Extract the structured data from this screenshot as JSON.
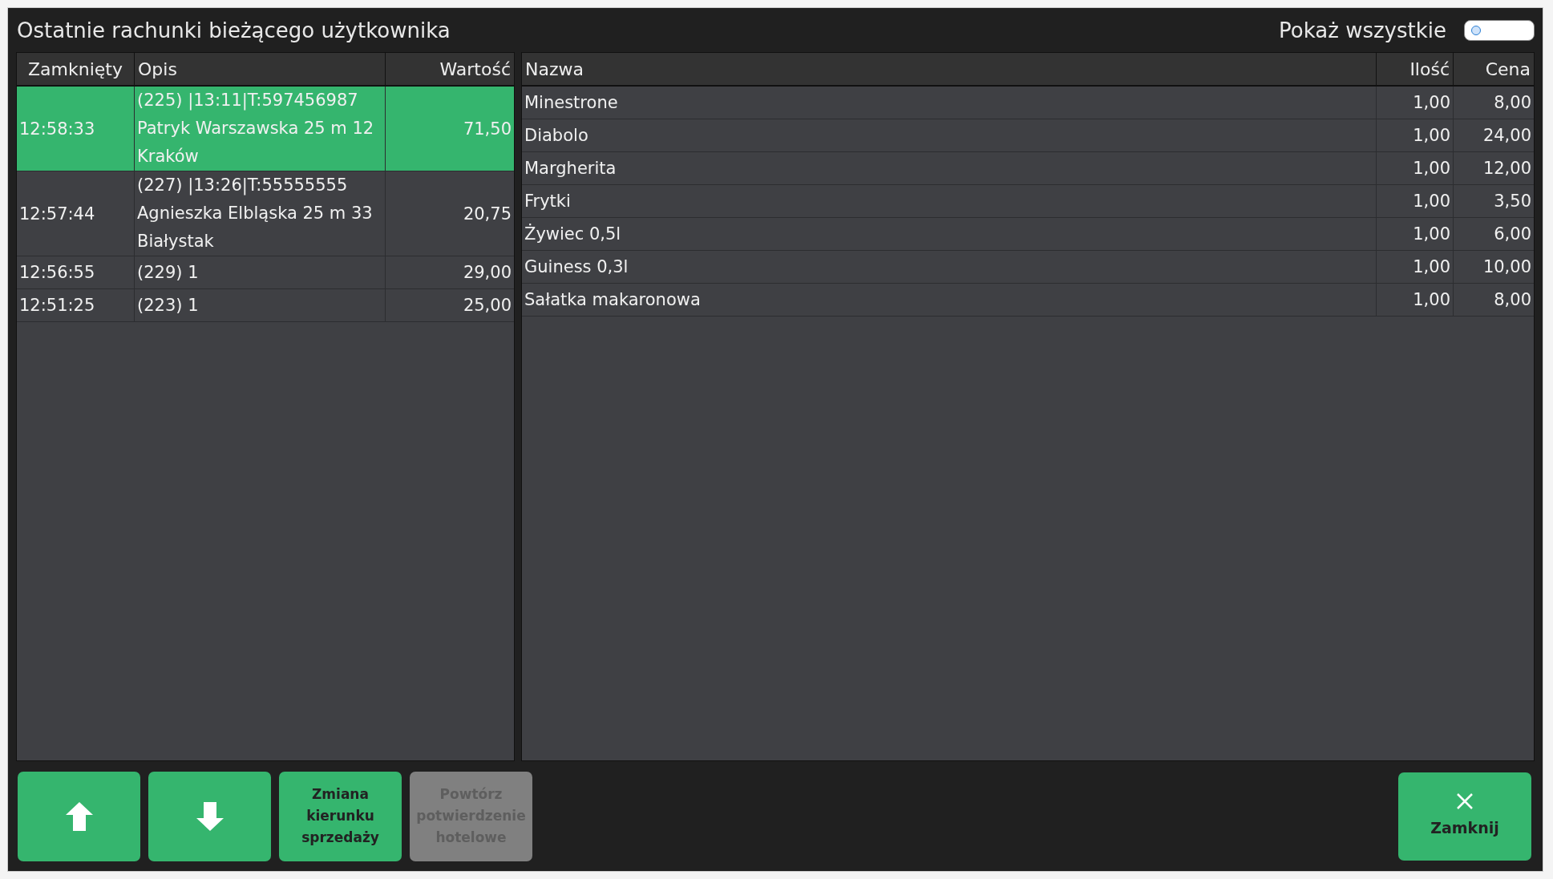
{
  "window": {
    "title": "Ostatnie rachunki bieżącego użytkownika"
  },
  "show_all": {
    "label": "Pokaż wszystkie",
    "on": false
  },
  "bills": {
    "columns": [
      "Zamknięty",
      "Opis",
      "Wartość"
    ],
    "rows": [
      {
        "closed": "12:58:33",
        "description": [
          "(225) |13:11|T:597456987",
          "Patryk Warszawska 25 m 12",
          "Kraków"
        ],
        "value": "71,50",
        "selected": true
      },
      {
        "closed": "12:57:44",
        "description": [
          "(227) |13:26|T:55555555",
          "Agnieszka Elbląska 25 m 33",
          "Białystak"
        ],
        "value": "20,75",
        "selected": false
      },
      {
        "closed": "12:56:55",
        "description": [
          "(229) 1"
        ],
        "value": "29,00",
        "selected": false
      },
      {
        "closed": "12:51:25",
        "description": [
          "(223) 1"
        ],
        "value": "25,00",
        "selected": false
      }
    ]
  },
  "items": {
    "columns": [
      "Nazwa",
      "Ilość",
      "Cena"
    ],
    "rows": [
      {
        "name": "Minestrone",
        "quantity": "1,00",
        "price": "8,00"
      },
      {
        "name": "Diabolo",
        "quantity": "1,00",
        "price": "24,00"
      },
      {
        "name": "Margherita",
        "quantity": "1,00",
        "price": "12,00"
      },
      {
        "name": "Frytki",
        "quantity": "1,00",
        "price": "3,50"
      },
      {
        "name": "Żywiec 0,5l",
        "quantity": "1,00",
        "price": "6,00"
      },
      {
        "name": "Guiness 0,3l",
        "quantity": "1,00",
        "price": "10,00"
      },
      {
        "name": "Sałatka makaronowa",
        "quantity": "1,00",
        "price": "8,00"
      }
    ]
  },
  "buttons": [
    {
      "kind": "up",
      "disabled": false
    },
    {
      "kind": "down",
      "disabled": false
    },
    {
      "kind": "text",
      "label": "Zmiana kierunku sprzedaży",
      "disabled": false
    },
    {
      "kind": "text",
      "label": "Powtórz potwierdzenie hotelowe",
      "disabled": true
    }
  ],
  "close_button": {
    "label": "Zamknij"
  }
}
